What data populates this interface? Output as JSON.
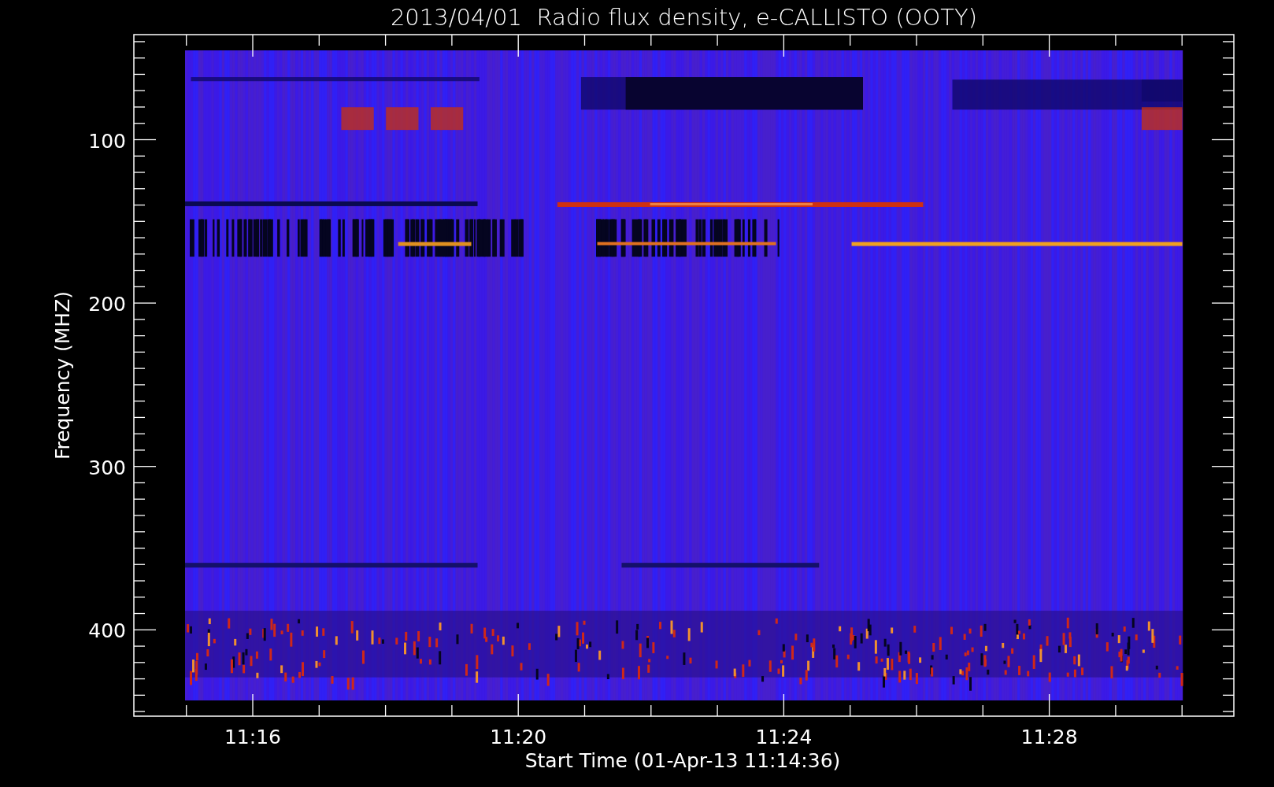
{
  "title": "2013/04/01  Radio flux density, e-CALLISTO (OOTY)",
  "y_axis": {
    "label": "Frequency (MHZ)",
    "ticks": [
      "100",
      "200",
      "300",
      "400"
    ]
  },
  "x_axis": {
    "label": "Start Time (01-Apr-13 11:14:36)",
    "ticks": [
      "11:16",
      "11:20",
      "11:24",
      "11:28"
    ]
  }
}
